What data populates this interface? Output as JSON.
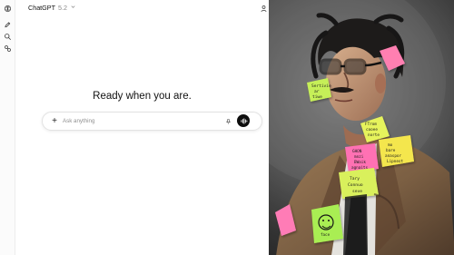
{
  "sidebar": {
    "icons": [
      "openai-logo-icon",
      "new-chat-icon",
      "search-icon",
      "library-icon"
    ]
  },
  "header": {
    "model_name": "ChatGPT",
    "model_version": "5.2",
    "icons": [
      "chevron-down-icon",
      "user-icon",
      "chat-bubble-icon"
    ]
  },
  "main": {
    "headline": "Ready when you are."
  },
  "composer": {
    "plus_label": "+",
    "placeholder": "Ask anything",
    "icons": [
      "plus-icon",
      "microphone-icon",
      "voice-mode-icon"
    ]
  },
  "photo": {
    "description_icon": "image",
    "sticky_notes": [
      {
        "color": "#c6ef58",
        "lines": [
          "Sertivie",
          "ar",
          "tiwe"
        ]
      },
      {
        "color": "#ff7fb1",
        "lines": []
      },
      {
        "color": "#e6f35b",
        "lines": [
          "FTrom",
          "cooee",
          "norte"
        ]
      },
      {
        "color": "#f4e64e",
        "lines": [
          "mo",
          "bare",
          "anaspor",
          "Lipnest"
        ]
      },
      {
        "color": "#ff71b3",
        "lines": [
          "GHON",
          "mnzi",
          "BWaik",
          "agnaits"
        ]
      },
      {
        "color": "#d9f05b",
        "lines": [
          "Tary",
          "Connuo",
          "seve"
        ]
      },
      {
        "color": "#ff7bb6",
        "lines": []
      },
      {
        "color": "#a9ee53",
        "lines": [
          "face"
        ]
      }
    ]
  }
}
